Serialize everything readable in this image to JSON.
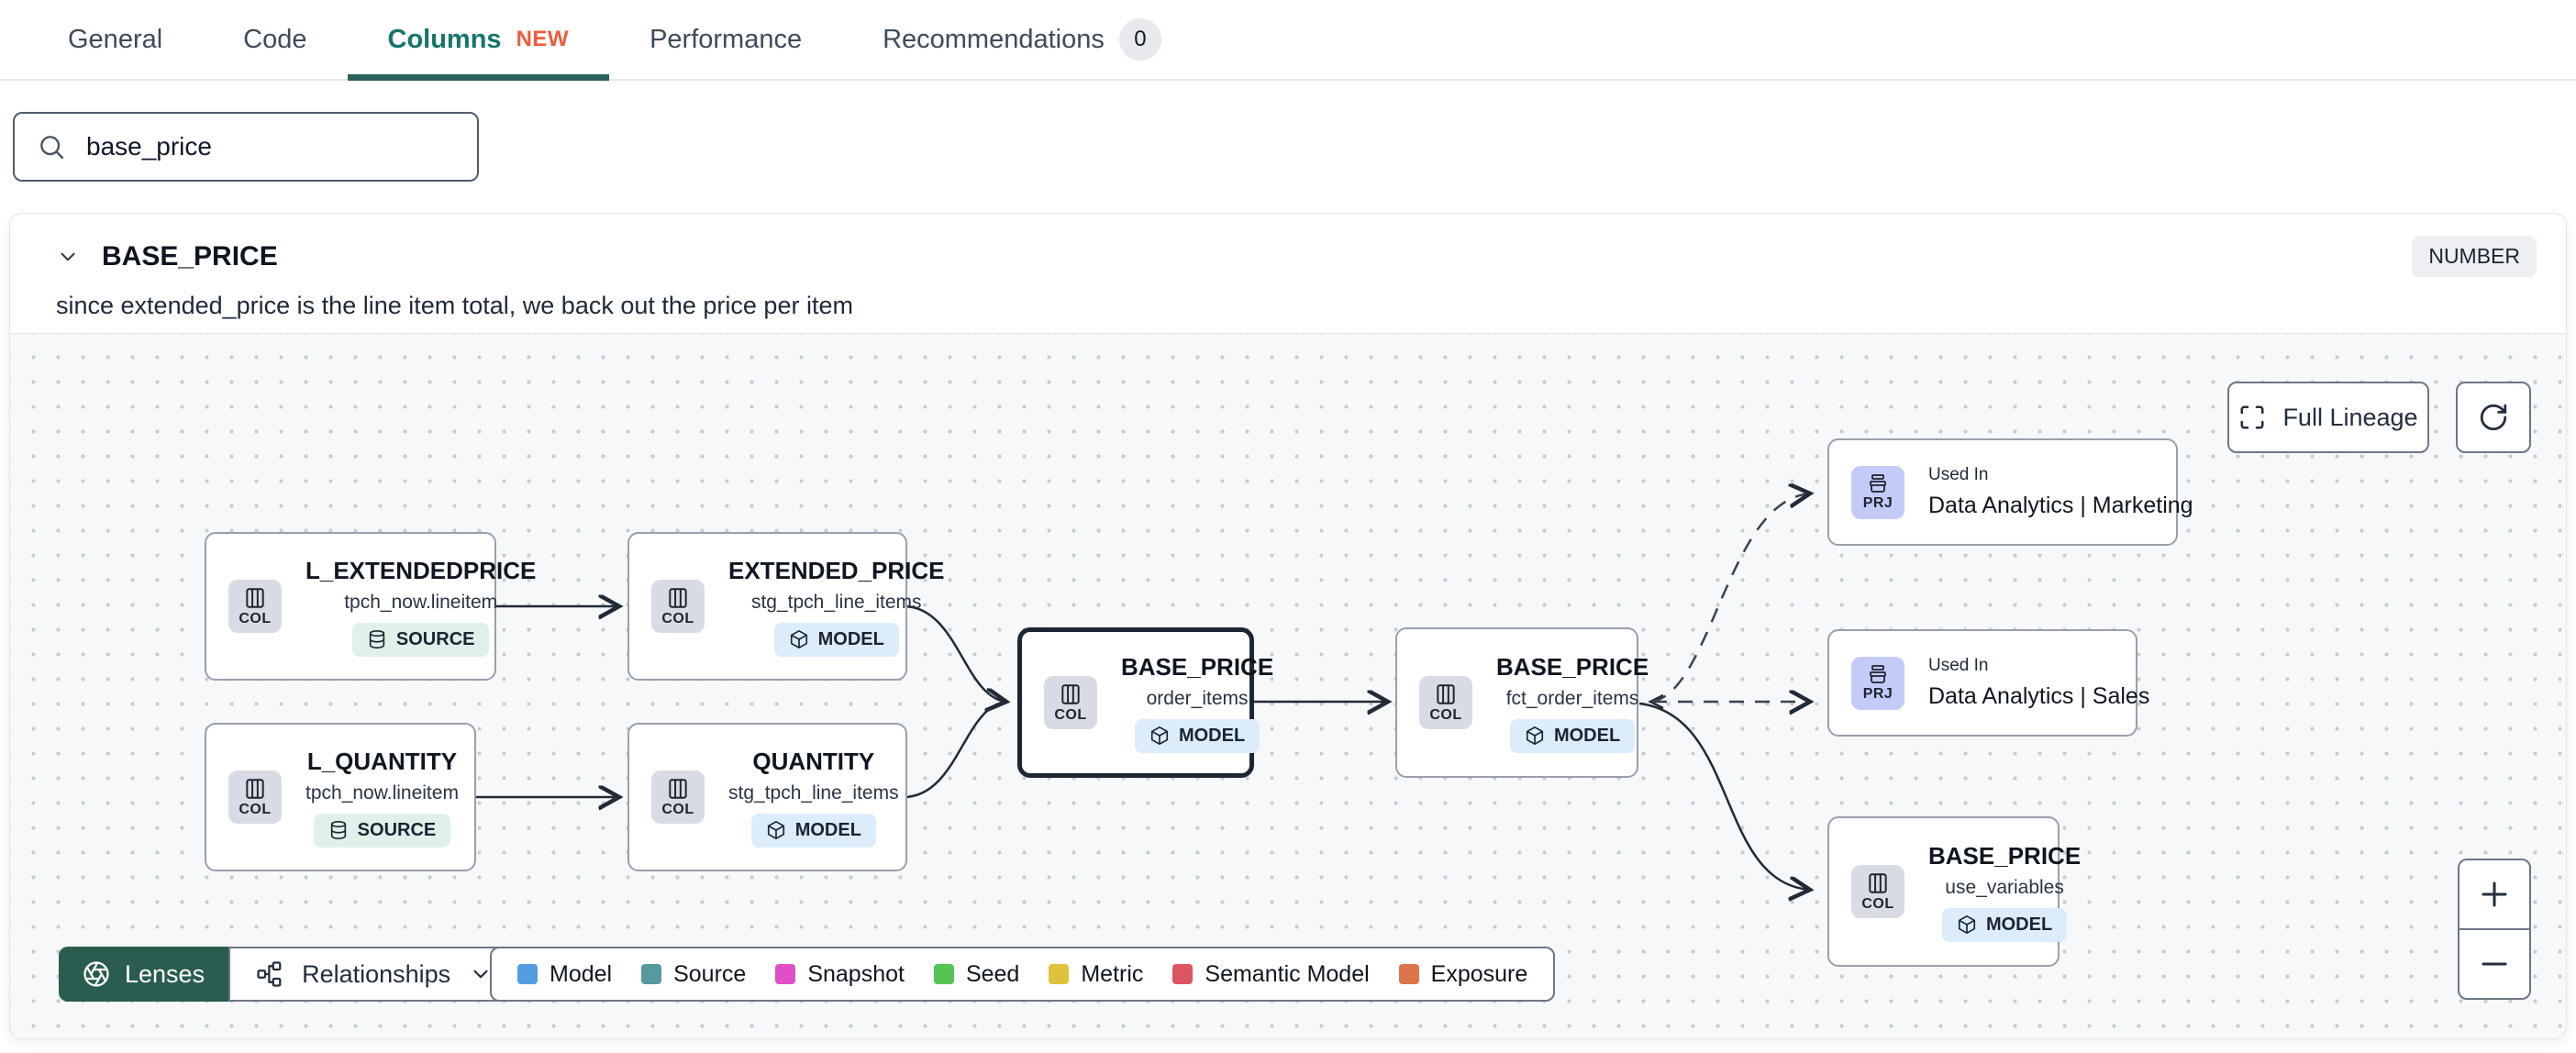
{
  "tabs": {
    "general": "General",
    "code": "Code",
    "columns": "Columns",
    "columns_badge": "NEW",
    "performance": "Performance",
    "recommendations": "Recommendations",
    "recommendations_count": "0"
  },
  "search": {
    "value": "base_price"
  },
  "column_panel": {
    "title": "BASE_PRICE",
    "type_badge": "NUMBER",
    "description": "since extended_price is the line item total, we back out the price per item"
  },
  "lineage": {
    "nodes": [
      {
        "chip": "COL",
        "title": "L_EXTENDEDPRICE",
        "subtitle": "tpch_now.lineitem",
        "badge": "SOURCE"
      },
      {
        "chip": "COL",
        "title": "L_QUANTITY",
        "subtitle": "tpch_now.lineitem",
        "badge": "SOURCE"
      },
      {
        "chip": "COL",
        "title": "EXTENDED_PRICE",
        "subtitle": "stg_tpch_line_items",
        "badge": "MODEL"
      },
      {
        "chip": "COL",
        "title": "QUANTITY",
        "subtitle": "stg_tpch_line_items",
        "badge": "MODEL"
      },
      {
        "chip": "COL",
        "title": "BASE_PRICE",
        "subtitle": "order_items",
        "badge": "MODEL"
      },
      {
        "chip": "COL",
        "title": "BASE_PRICE",
        "subtitle": "fct_order_items",
        "badge": "MODEL"
      },
      {
        "chip": "PRJ",
        "label": "Used In",
        "name": "Data Analytics | Marketing"
      },
      {
        "chip": "PRJ",
        "label": "Used In",
        "name": "Data Analytics | Sales"
      },
      {
        "chip": "COL",
        "title": "BASE_PRICE",
        "subtitle": "use_variables",
        "badge": "MODEL"
      }
    ],
    "controls": {
      "full_lineage": "Full Lineage",
      "lenses": "Lenses",
      "relationships": "Relationships",
      "zoom_in": "+",
      "zoom_out": "−"
    },
    "legend": [
      {
        "label": "Model",
        "color": "#529ee0"
      },
      {
        "label": "Source",
        "color": "#57999e"
      },
      {
        "label": "Snapshot",
        "color": "#e14fc7"
      },
      {
        "label": "Seed",
        "color": "#55c353"
      },
      {
        "label": "Metric",
        "color": "#ddc33c"
      },
      {
        "label": "Semantic Model",
        "color": "#dd5560"
      },
      {
        "label": "Exposure",
        "color": "#de7449"
      }
    ],
    "colors": {
      "active_tab": "#15756b",
      "new_badge": "#ee5b3d",
      "lenses_button": "#2a5c50",
      "model_badge_bg": "#dcecfb",
      "source_badge_bg": "#dff1ea",
      "col_chip_bg": "#d8dbe3",
      "prj_chip_bg": "#c5cbf8"
    }
  }
}
